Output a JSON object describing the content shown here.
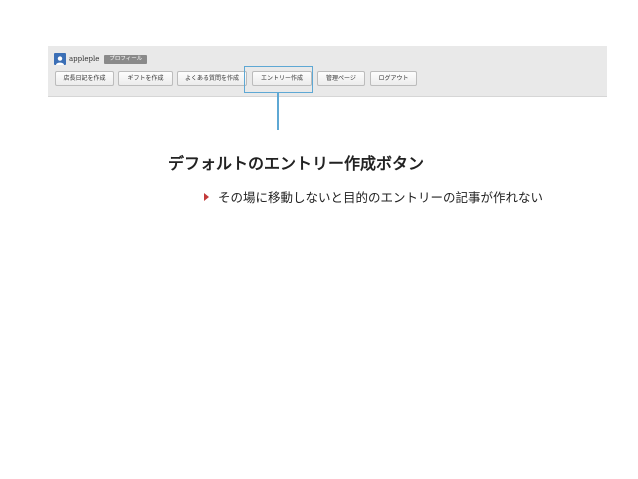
{
  "toolbar": {
    "username": "appleple",
    "profile_label": "プロフィール",
    "buttons": [
      {
        "label": "店長日記を作成"
      },
      {
        "label": "ギフトを作成"
      },
      {
        "label": "よくある質問を作成"
      },
      {
        "label": "エントリー作成"
      },
      {
        "label": "管理ページ"
      },
      {
        "label": "ログアウト"
      }
    ]
  },
  "annotation": {
    "heading": "デフォルトのエントリー作成ボタン",
    "bullet": "その場に移動しないと目的のエントリーの記事が作れない",
    "colors": {
      "highlight": "#5ea8d4",
      "bullet": "#c33a3a"
    }
  }
}
